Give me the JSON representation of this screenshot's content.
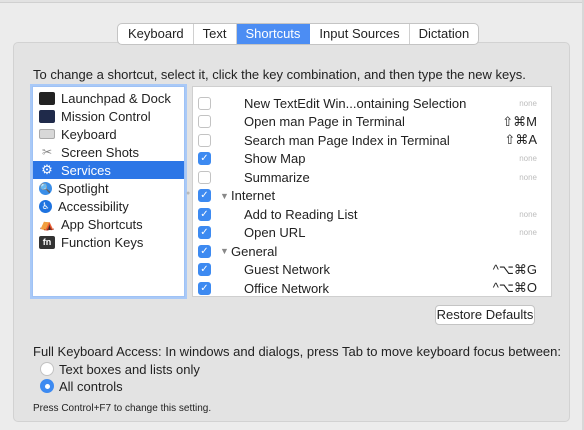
{
  "tabs": [
    "Keyboard",
    "Text",
    "Shortcuts",
    "Input Sources",
    "Dictation"
  ],
  "active_tab": "Shortcuts",
  "instruction": "To change a shortcut, select it, click the key combination, and then type the new keys.",
  "categories": [
    {
      "label": "Launchpad & Dock",
      "icon": "launchpad-icon"
    },
    {
      "label": "Mission Control",
      "icon": "mission-control-icon"
    },
    {
      "label": "Keyboard",
      "icon": "keyboard-icon"
    },
    {
      "label": "Screen Shots",
      "icon": "screenshot-icon"
    },
    {
      "label": "Services",
      "icon": "services-gear-icon"
    },
    {
      "label": "Spotlight",
      "icon": "spotlight-icon"
    },
    {
      "label": "Accessibility",
      "icon": "accessibility-icon"
    },
    {
      "label": "App Shortcuts",
      "icon": "app-shortcuts-icon"
    },
    {
      "label": "Function Keys",
      "icon": "fn-key-icon"
    }
  ],
  "selected_category": "Services",
  "category_icon_glyphs": {
    "launchpad-icon": "",
    "mission-control-icon": "",
    "keyboard-icon": "",
    "screenshot-icon": "✂",
    "services-gear-icon": "⚙",
    "spotlight-icon": "🔍",
    "accessibility-icon": "♿",
    "app-shortcuts-icon": "⛺",
    "fn-key-icon": "fn"
  },
  "shortcuts": [
    {
      "type": "item",
      "label": "New TextEdit Win...ontaining Selection",
      "checked": false,
      "shortcut": "none"
    },
    {
      "type": "item",
      "label": "Open man Page in Terminal",
      "checked": false,
      "shortcut": "⇧⌘M"
    },
    {
      "type": "item",
      "label": "Search man Page Index in Terminal",
      "checked": false,
      "shortcut": "⇧⌘A"
    },
    {
      "type": "item",
      "label": "Show Map",
      "checked": true,
      "shortcut": "none"
    },
    {
      "type": "item",
      "label": "Summarize",
      "checked": false,
      "shortcut": "none"
    },
    {
      "type": "group",
      "label": "Internet",
      "checked": true,
      "shortcut": ""
    },
    {
      "type": "item",
      "label": "Add to Reading List",
      "checked": true,
      "shortcut": "none"
    },
    {
      "type": "item",
      "label": "Open URL",
      "checked": true,
      "shortcut": "none"
    },
    {
      "type": "group",
      "label": "General",
      "checked": true,
      "shortcut": ""
    },
    {
      "type": "item",
      "label": "Guest Network",
      "checked": true,
      "shortcut": "^⌥⌘G"
    },
    {
      "type": "item",
      "label": "Office Network",
      "checked": true,
      "shortcut": "^⌥⌘O"
    }
  ],
  "restore_button": "Restore Defaults",
  "full_keyboard_access": "Full Keyboard Access: In windows and dialogs, press Tab to move keyboard focus between:",
  "radio_options": [
    {
      "label": "Text boxes and lists only",
      "selected": false
    },
    {
      "label": "All controls",
      "selected": true
    }
  ],
  "hint": "Press Control+F7 to change this setting.",
  "colors": {
    "accent": "#3d8af1",
    "selection": "#2c76e6"
  }
}
